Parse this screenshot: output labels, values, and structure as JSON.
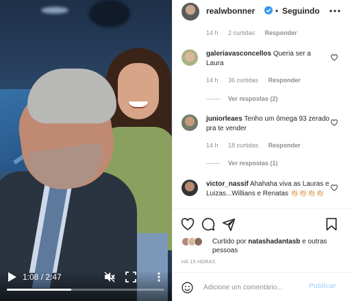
{
  "video": {
    "current_time": "1:08",
    "duration": "2:47",
    "time_display": "1:08 / 2:47",
    "progress_fraction": 0.407,
    "muted": true
  },
  "post": {
    "username": "realwbonner",
    "verified": true,
    "separator": "•",
    "follow_status": "Seguindo"
  },
  "comments": [
    {
      "meta": {
        "age": "14 h",
        "likes": "2 curtidas",
        "reply": "Responder"
      }
    },
    {
      "username": "galeriavasconcellos",
      "text": "Queria ser a Laura",
      "meta": {
        "age": "14 h",
        "likes": "36 curtidas",
        "reply": "Responder"
      },
      "view_replies": "Ver respostas (2)"
    },
    {
      "username": "juniorleaes",
      "text": "Tenho um ômega 93 zerado pra te vender",
      "meta": {
        "age": "14 h",
        "likes": "18 curtidas",
        "reply": "Responder"
      },
      "view_replies": "Ver respostas (1)"
    },
    {
      "username": "victor_nassif",
      "text": "Ahahaha viva as Lauras e Luizas...Willians e Renatas 👏🏻👏🏻👏🏻👏🏻"
    }
  ],
  "likes": {
    "prefix": "Curtido por",
    "liker": "natashadantasb",
    "suffix": "e outras pessoas"
  },
  "post_time": "HÁ 15 HORAS",
  "add_comment": {
    "placeholder": "Adicione um comentário...",
    "publish_label": "Publicar"
  },
  "colors": {
    "verified_badge": "#3897f0",
    "publish_disabled": "#b3dbff",
    "muted_text": "#8e8e8e"
  }
}
